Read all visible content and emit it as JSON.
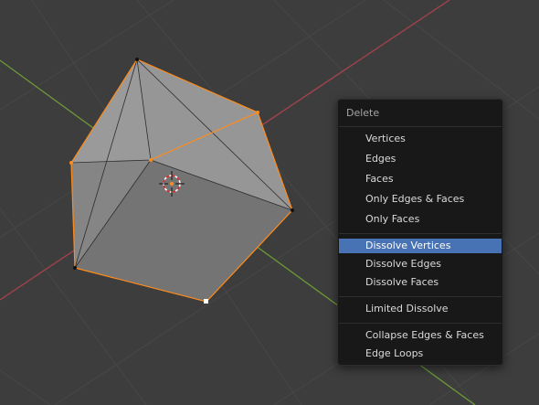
{
  "menu": {
    "title": "Delete",
    "items": [
      {
        "label": "Vertices"
      },
      {
        "label": "Edges"
      },
      {
        "label": "Faces"
      },
      {
        "label": "Only Edges & Faces"
      },
      {
        "label": "Only Faces"
      },
      {
        "label": "Dissolve Vertices",
        "highlighted": true
      },
      {
        "label": "Dissolve Edges"
      },
      {
        "label": "Dissolve Faces"
      },
      {
        "label": "Limited Dissolve"
      },
      {
        "label": "Collapse Edges & Faces"
      },
      {
        "label": "Edge Loops"
      }
    ]
  },
  "colors": {
    "viewport_background": "#3d3d3d",
    "grid_line": "#474747",
    "x_axis": "#a8424e",
    "y_axis": "#6b9a37",
    "selection_orange": "#ff8c1a",
    "menu_background": "#181818",
    "menu_highlight": "#4772b3"
  },
  "viewport": {
    "object": "cube-mesh",
    "mode": "edit-mode",
    "icons": [
      "3d-cursor-icon"
    ]
  }
}
